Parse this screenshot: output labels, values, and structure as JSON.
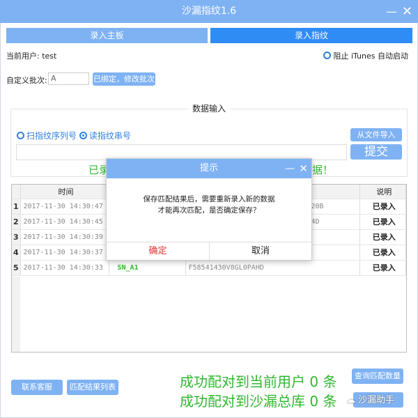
{
  "window": {
    "title": "沙漏指纹1.6",
    "minimize_icon": "minimize-icon",
    "close_icon": "close-icon"
  },
  "tabs": [
    {
      "label": "录入主板",
      "active": false
    },
    {
      "label": "录入指纹",
      "active": true
    }
  ],
  "user": {
    "label": "当前用户:",
    "value": "test"
  },
  "itunes": {
    "label": "阻止 iTunes 自动启动",
    "checked": false
  },
  "batch": {
    "label": "自定义批次:",
    "value": "A",
    "button": "已绑定，修改批次"
  },
  "input_section": {
    "title": "数据输入",
    "radio_scan": "扫指纹序列号",
    "radio_read": "读指纹串号",
    "selected": "读指纹串号",
    "import_button": "从文件导入",
    "submit_button": "提交",
    "status_left": "已录",
    "status_right": "据！"
  },
  "table": {
    "headers": [
      "时间",
      "",
      "",
      "说明"
    ],
    "rows": [
      {
        "n": "1",
        "time": "2017-11-30 14:30:47",
        "sn": "",
        "serial": "20B",
        "status": "已录入"
      },
      {
        "n": "2",
        "time": "2017-11-30 14:30:45",
        "sn": "",
        "serial": "4D",
        "status": "已录入"
      },
      {
        "n": "3",
        "time": "2017-11-30 14:30:39",
        "sn": "",
        "serial": "",
        "status": "已录入"
      },
      {
        "n": "4",
        "time": "2017-11-30 14:30:37",
        "sn": "",
        "serial": "",
        "status": "已录入"
      },
      {
        "n": "5",
        "time": "2017-11-30 14:30:33",
        "sn": "SN_A1",
        "serial": "F58541430V8GL0PAHD",
        "status": "已录入"
      }
    ]
  },
  "dialog": {
    "title": "提示",
    "line1": "保存匹配结果后，需要重新录入新的数据",
    "line2": "才能再次匹配，是否确定保存？",
    "ok": "确定",
    "cancel": "取消"
  },
  "footer": {
    "contact": "联系客服",
    "results": "匹配结果列表",
    "query": "查询匹配数量",
    "match_user": "成功配对到当前用户 0 条",
    "match_total": "成功配对到沙漏总库 0 条",
    "watermark": "沙漏助手"
  },
  "colors": {
    "accent": "#2f8cf5",
    "light_accent": "#7fb2f3",
    "green": "#2fb82f",
    "danger": "#e03030"
  }
}
